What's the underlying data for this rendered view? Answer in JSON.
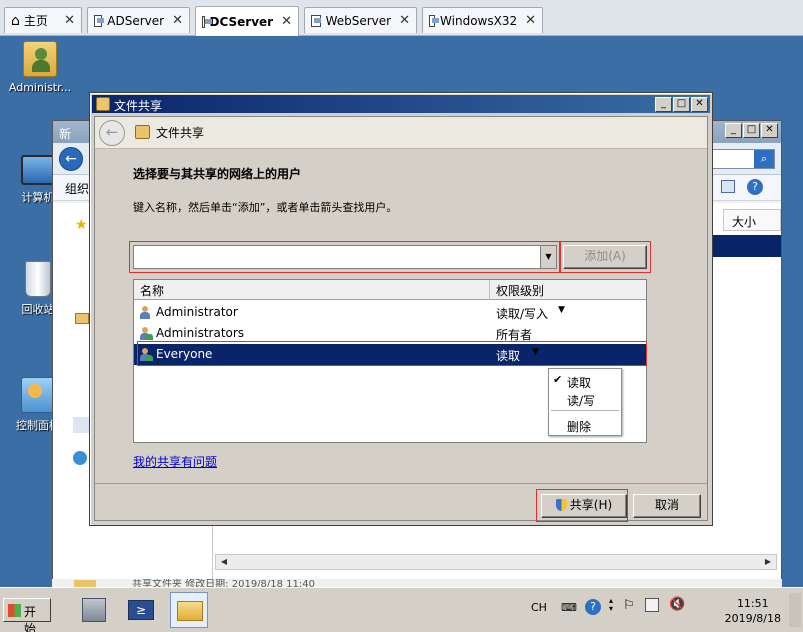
{
  "tabs": [
    {
      "label": "主页",
      "icon": "home-icon"
    },
    {
      "label": "ADServer",
      "icon": "vm-icon"
    },
    {
      "label": "DCServer",
      "icon": "vm-icon",
      "active": true
    },
    {
      "label": "WebServer",
      "icon": "vm-icon"
    },
    {
      "label": "WindowsX32",
      "icon": "vm-icon"
    }
  ],
  "desktop": {
    "icons": [
      {
        "label": "Administr...",
        "icon": "user-folder-icon"
      },
      {
        "label": "计算机",
        "icon": "computer-icon"
      },
      {
        "label": "回收站",
        "icon": "recycle-bin-icon"
      },
      {
        "label": "控制面板",
        "icon": "control-panel-icon"
      }
    ]
  },
  "bg_window": {
    "title": "新",
    "toolbar_label": "组织",
    "column_size": "大小"
  },
  "dialog": {
    "title": "文件共享",
    "wizard_title": "文件共享",
    "heading": "选择要与其共享的网络上的用户",
    "instruction": "键入名称，然后单击“添加”，或者单击箭头查找用户。",
    "name_input_value": "",
    "add_button": "添加(A)",
    "columns": {
      "name": "名称",
      "permission": "权限级别"
    },
    "rows": [
      {
        "name": "Administrator",
        "permission": "读取/写入",
        "has_dropdown": true
      },
      {
        "name": "Administrators",
        "permission": "所有者",
        "has_dropdown": false
      },
      {
        "name": "Everyone",
        "permission": "读取",
        "has_dropdown": true,
        "selected": true
      }
    ],
    "permission_menu": {
      "items": [
        "读取",
        "读/写",
        "删除"
      ],
      "checked": "读取"
    },
    "help_link": "我的共享有问题",
    "share_button": "共享(H)",
    "cancel_button": "取消"
  },
  "bg_status": "共享文件夹 修改日期: 2019/8/18 11:40",
  "taskbar": {
    "start_label": "开始",
    "lang": "CH",
    "time": "11:51",
    "date": "2019/8/18"
  },
  "colors": {
    "desktop": "#3a6ea5",
    "title_active": "#0a246a",
    "highlight_box": "#e03030",
    "selection": "#0a246a"
  }
}
